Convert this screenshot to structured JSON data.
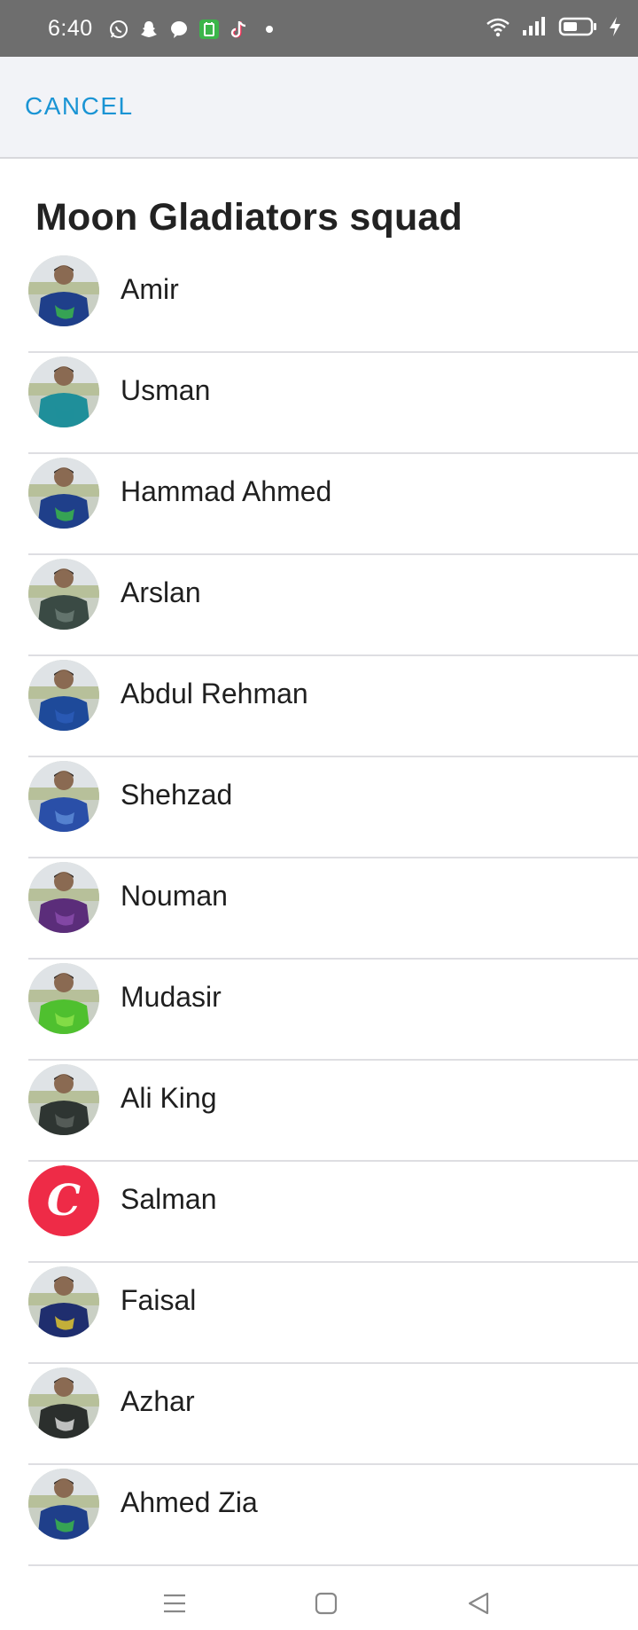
{
  "status_bar": {
    "time": "6:40",
    "left_icons": [
      "whatsapp-icon",
      "snapchat-icon",
      "messenger-icon",
      "app-icon",
      "tiktok-icon",
      "dot-icon"
    ],
    "right_icons": [
      "wifi-icon",
      "signal-icon",
      "battery-icon",
      "charging-icon"
    ]
  },
  "header": {
    "cancel_label": "CANCEL"
  },
  "squad": {
    "title": "Moon Gladiators squad",
    "players": [
      {
        "name": "Amir",
        "jersey": "#1f3f8a",
        "accent": "#3bb54a"
      },
      {
        "name": "Usman",
        "jersey": "#1f8f9a",
        "accent": "#1f8f9a"
      },
      {
        "name": "Hammad Ahmed",
        "jersey": "#1f3f8a",
        "accent": "#3bb54a"
      },
      {
        "name": "Arslan",
        "jersey": "#3a4a44",
        "accent": "#6b7b74"
      },
      {
        "name": "Abdul Rehman",
        "jersey": "#1e4a9a",
        "accent": "#2c5cb8"
      },
      {
        "name": "Shehzad",
        "jersey": "#2a4fa8",
        "accent": "#5c8ad6"
      },
      {
        "name": "Nouman",
        "jersey": "#5b2d7a",
        "accent": "#8a4cab"
      },
      {
        "name": "Mudasir",
        "jersey": "#4fc02f",
        "accent": "#8be04a"
      },
      {
        "name": "Ali King",
        "jersey": "#2e3532",
        "accent": "#5a625e"
      },
      {
        "name": "Salman",
        "jersey": "#ee2b47",
        "accent": "#ffffff",
        "logo_letter": "C"
      },
      {
        "name": "Faisal",
        "jersey": "#1f2e6e",
        "accent": "#e1c630"
      },
      {
        "name": "Azhar",
        "jersey": "#2b2f2d",
        "accent": "#d9d9d9"
      },
      {
        "name": "Ahmed Zia",
        "jersey": "#1f3f8a",
        "accent": "#3bb54a"
      }
    ]
  },
  "nav": {
    "buttons": [
      "menu-icon",
      "home-icon",
      "back-icon"
    ]
  }
}
